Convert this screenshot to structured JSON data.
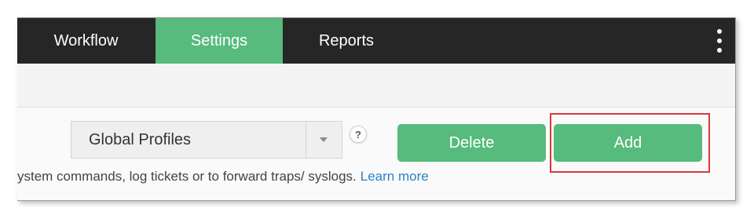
{
  "nav": {
    "tabs": [
      {
        "label": "Workflow",
        "active": false
      },
      {
        "label": "Settings",
        "active": true
      },
      {
        "label": "Reports",
        "active": false
      }
    ],
    "more_icon": "kebab-vertical-icon"
  },
  "toolbar": {
    "profile_select": {
      "value": "Global Profiles"
    },
    "help_label": "?",
    "delete_label": "Delete",
    "add_label": "Add"
  },
  "description": {
    "text": "ystem commands, log tickets or to forward traps/ syslogs.",
    "link_label": "Learn more"
  },
  "colors": {
    "nav_bg": "#262626",
    "accent_green": "#56bb7c",
    "link_blue": "#2a83c6",
    "highlight_red": "#d63a3a"
  }
}
